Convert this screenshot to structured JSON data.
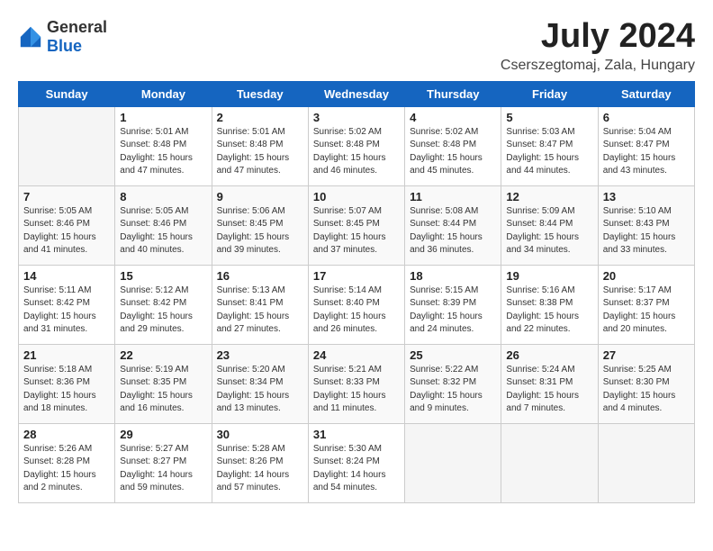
{
  "logo": {
    "general": "General",
    "blue": "Blue"
  },
  "header": {
    "month": "July 2024",
    "location": "Cserszegtomaj, Zala, Hungary"
  },
  "weekdays": [
    "Sunday",
    "Monday",
    "Tuesday",
    "Wednesday",
    "Thursday",
    "Friday",
    "Saturday"
  ],
  "weeks": [
    [
      {
        "day": "",
        "empty": true
      },
      {
        "day": "1",
        "sunrise": "5:01 AM",
        "sunset": "8:48 PM",
        "daylight": "15 hours and 47 minutes."
      },
      {
        "day": "2",
        "sunrise": "5:01 AM",
        "sunset": "8:48 PM",
        "daylight": "15 hours and 47 minutes."
      },
      {
        "day": "3",
        "sunrise": "5:02 AM",
        "sunset": "8:48 PM",
        "daylight": "15 hours and 46 minutes."
      },
      {
        "day": "4",
        "sunrise": "5:02 AM",
        "sunset": "8:48 PM",
        "daylight": "15 hours and 45 minutes."
      },
      {
        "day": "5",
        "sunrise": "5:03 AM",
        "sunset": "8:47 PM",
        "daylight": "15 hours and 44 minutes."
      },
      {
        "day": "6",
        "sunrise": "5:04 AM",
        "sunset": "8:47 PM",
        "daylight": "15 hours and 43 minutes."
      }
    ],
    [
      {
        "day": "7",
        "sunrise": "5:05 AM",
        "sunset": "8:46 PM",
        "daylight": "15 hours and 41 minutes."
      },
      {
        "day": "8",
        "sunrise": "5:05 AM",
        "sunset": "8:46 PM",
        "daylight": "15 hours and 40 minutes."
      },
      {
        "day": "9",
        "sunrise": "5:06 AM",
        "sunset": "8:45 PM",
        "daylight": "15 hours and 39 minutes."
      },
      {
        "day": "10",
        "sunrise": "5:07 AM",
        "sunset": "8:45 PM",
        "daylight": "15 hours and 37 minutes."
      },
      {
        "day": "11",
        "sunrise": "5:08 AM",
        "sunset": "8:44 PM",
        "daylight": "15 hours and 36 minutes."
      },
      {
        "day": "12",
        "sunrise": "5:09 AM",
        "sunset": "8:44 PM",
        "daylight": "15 hours and 34 minutes."
      },
      {
        "day": "13",
        "sunrise": "5:10 AM",
        "sunset": "8:43 PM",
        "daylight": "15 hours and 33 minutes."
      }
    ],
    [
      {
        "day": "14",
        "sunrise": "5:11 AM",
        "sunset": "8:42 PM",
        "daylight": "15 hours and 31 minutes."
      },
      {
        "day": "15",
        "sunrise": "5:12 AM",
        "sunset": "8:42 PM",
        "daylight": "15 hours and 29 minutes."
      },
      {
        "day": "16",
        "sunrise": "5:13 AM",
        "sunset": "8:41 PM",
        "daylight": "15 hours and 27 minutes."
      },
      {
        "day": "17",
        "sunrise": "5:14 AM",
        "sunset": "8:40 PM",
        "daylight": "15 hours and 26 minutes."
      },
      {
        "day": "18",
        "sunrise": "5:15 AM",
        "sunset": "8:39 PM",
        "daylight": "15 hours and 24 minutes."
      },
      {
        "day": "19",
        "sunrise": "5:16 AM",
        "sunset": "8:38 PM",
        "daylight": "15 hours and 22 minutes."
      },
      {
        "day": "20",
        "sunrise": "5:17 AM",
        "sunset": "8:37 PM",
        "daylight": "15 hours and 20 minutes."
      }
    ],
    [
      {
        "day": "21",
        "sunrise": "5:18 AM",
        "sunset": "8:36 PM",
        "daylight": "15 hours and 18 minutes."
      },
      {
        "day": "22",
        "sunrise": "5:19 AM",
        "sunset": "8:35 PM",
        "daylight": "15 hours and 16 minutes."
      },
      {
        "day": "23",
        "sunrise": "5:20 AM",
        "sunset": "8:34 PM",
        "daylight": "15 hours and 13 minutes."
      },
      {
        "day": "24",
        "sunrise": "5:21 AM",
        "sunset": "8:33 PM",
        "daylight": "15 hours and 11 minutes."
      },
      {
        "day": "25",
        "sunrise": "5:22 AM",
        "sunset": "8:32 PM",
        "daylight": "15 hours and 9 minutes."
      },
      {
        "day": "26",
        "sunrise": "5:24 AM",
        "sunset": "8:31 PM",
        "daylight": "15 hours and 7 minutes."
      },
      {
        "day": "27",
        "sunrise": "5:25 AM",
        "sunset": "8:30 PM",
        "daylight": "15 hours and 4 minutes."
      }
    ],
    [
      {
        "day": "28",
        "sunrise": "5:26 AM",
        "sunset": "8:28 PM",
        "daylight": "15 hours and 2 minutes."
      },
      {
        "day": "29",
        "sunrise": "5:27 AM",
        "sunset": "8:27 PM",
        "daylight": "14 hours and 59 minutes."
      },
      {
        "day": "30",
        "sunrise": "5:28 AM",
        "sunset": "8:26 PM",
        "daylight": "14 hours and 57 minutes."
      },
      {
        "day": "31",
        "sunrise": "5:30 AM",
        "sunset": "8:24 PM",
        "daylight": "14 hours and 54 minutes."
      },
      {
        "day": "",
        "empty": true
      },
      {
        "day": "",
        "empty": true
      },
      {
        "day": "",
        "empty": true
      }
    ]
  ]
}
